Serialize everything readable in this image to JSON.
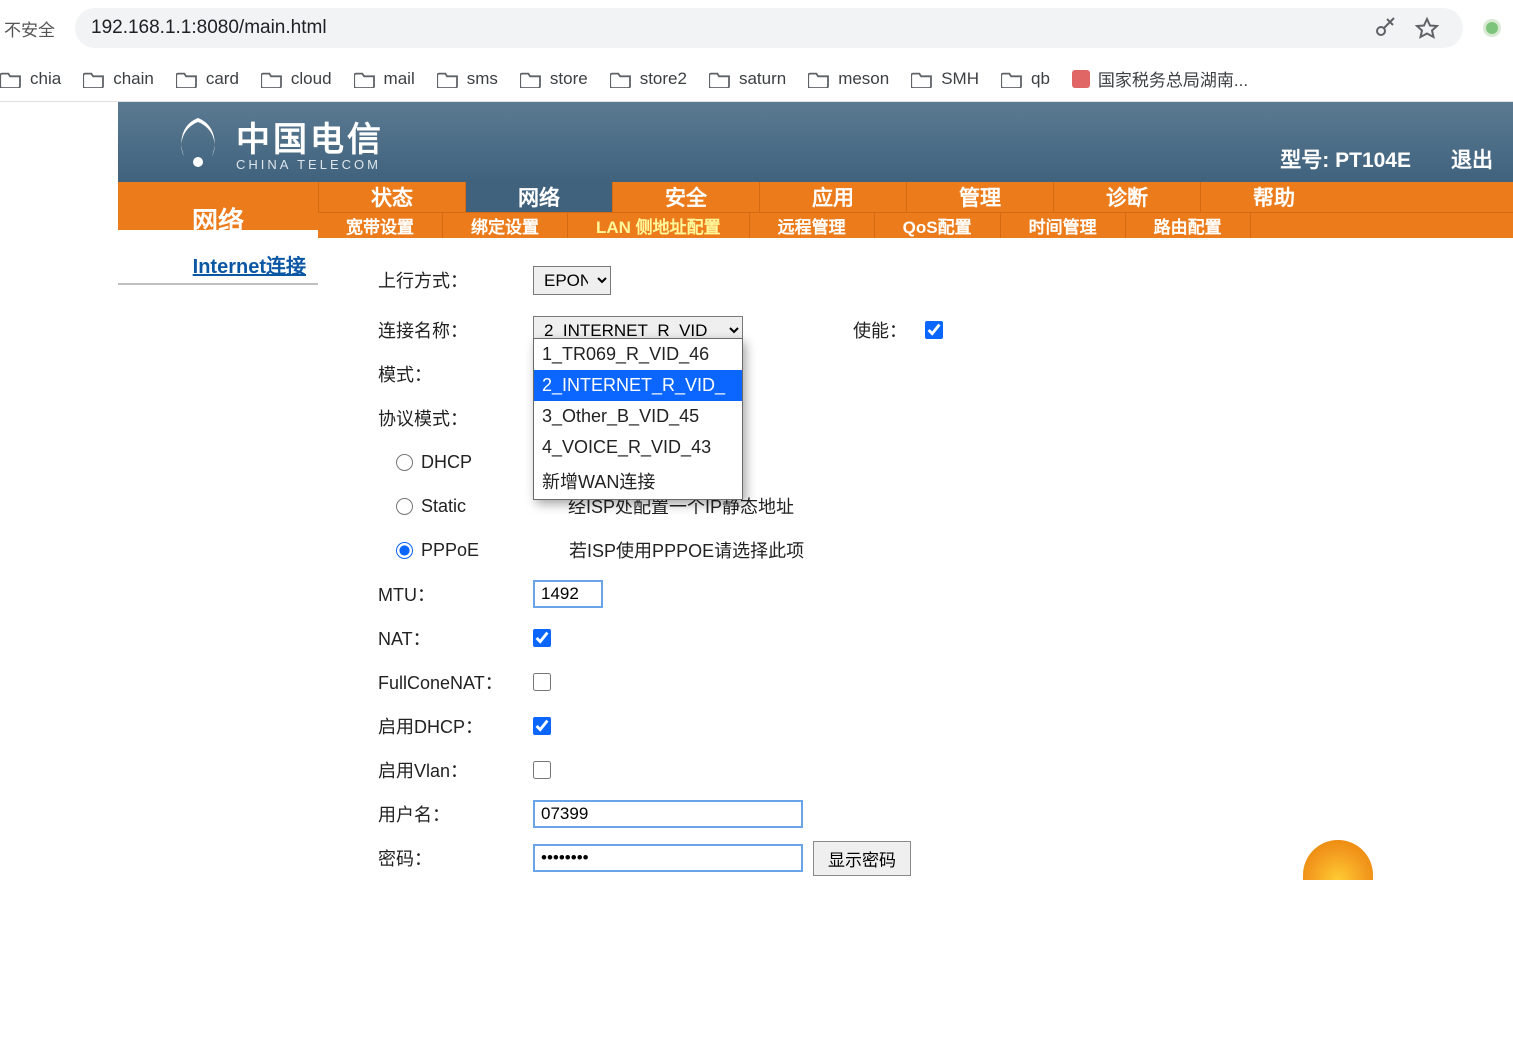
{
  "browser": {
    "security_label": "不安全",
    "url": "192.168.1.1:8080/main.html",
    "bookmarks": [
      {
        "label": "chia"
      },
      {
        "label": "chain"
      },
      {
        "label": "card"
      },
      {
        "label": "cloud"
      },
      {
        "label": "mail"
      },
      {
        "label": "sms"
      },
      {
        "label": "store"
      },
      {
        "label": "store2"
      },
      {
        "label": "saturn"
      },
      {
        "label": "meson"
      },
      {
        "label": "SMH"
      },
      {
        "label": "qb"
      }
    ],
    "extra_bookmark": "国家税务总局湖南..."
  },
  "router": {
    "brand_cn": "中国电信",
    "brand_en": "CHINA TELECOM",
    "model_label": "型号: PT104E",
    "logout": "退出",
    "nav_main": [
      "状态",
      "网络",
      "安全",
      "应用",
      "管理",
      "诊断",
      "帮助"
    ],
    "nav_main_active": "网络",
    "nav_sub": [
      "宽带设置",
      "绑定设置",
      "LAN 侧地址配置",
      "远程管理",
      "QoS配置",
      "时间管理",
      "路由配置"
    ],
    "nav_sub_active": "LAN 侧地址配置",
    "side_title": "网络",
    "side_link": "Internet连接",
    "form": {
      "uplink_label": "上行方式：",
      "uplink_value": "EPON",
      "conn_label": "连接名称：",
      "conn_value": "2_INTERNET_R_VID_",
      "conn_options": [
        "1_TR069_R_VID_46",
        "2_INTERNET_R_VID_",
        "3_Other_B_VID_45",
        "4_VOICE_R_VID_43",
        "新增WAN连接"
      ],
      "enable_label": "使能：",
      "enable_checked": true,
      "mode_label": "模式：",
      "proto_label": "协议模式：",
      "dhcp_label": "DHCP",
      "static_label": "Static",
      "static_desc": "经ISP处配置一个IP静态地址",
      "pppoe_label": "PPPoE",
      "pppoe_desc": "若ISP使用PPPOE请选择此项",
      "proto_selected": "PPPoE",
      "mtu_label": "MTU：",
      "mtu_value": "1492",
      "nat_label": "NAT：",
      "nat_checked": true,
      "fullcone_label": "FullConeNAT：",
      "fullcone_checked": false,
      "dhcp_enable_label": "启用DHCP：",
      "dhcp_enable_checked": true,
      "vlan_label": "启用Vlan：",
      "vlan_checked": false,
      "user_label": "用户名：",
      "user_value": "07399",
      "pwd_label": "密码：",
      "pwd_value": "••••••••",
      "show_pwd_btn": "显示密码"
    }
  }
}
